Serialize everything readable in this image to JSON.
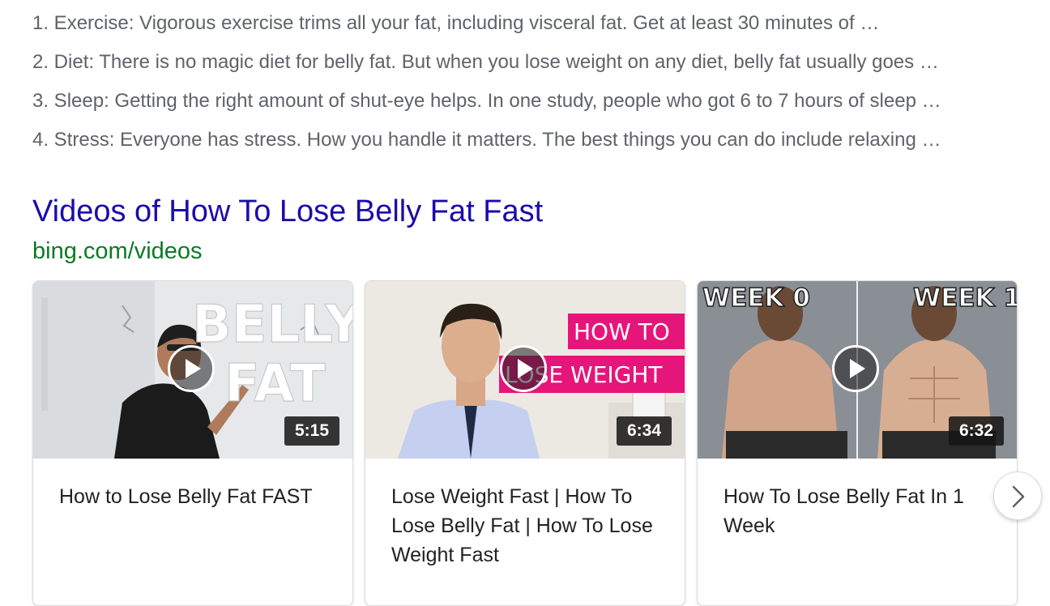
{
  "tips": [
    "1. Exercise: Vigorous exercise trims all your fat, including visceral fat. Get at least 30 minutes of …",
    "2. Diet: There is no magic diet for belly fat. But when you lose weight on any diet, belly fat usually goes …",
    "3. Sleep: Getting the right amount of shut-eye helps. In one study, people who got 6 to 7 hours of sleep …",
    "4. Stress: Everyone has stress. How you handle it matters. The best things you can do include relaxing …"
  ],
  "videos_section": {
    "title": "Videos of How To Lose Belly Fat Fast",
    "source": "bing.com/videos",
    "cards": [
      {
        "title": "How to Lose Belly Fat FAST",
        "duration": "5:15",
        "thumb_text": [
          "BELLY",
          "FAT"
        ]
      },
      {
        "title": "Lose Weight Fast | How To Lose Belly Fat | How To Lose Weight Fast",
        "duration": "6:34",
        "thumb_text": [
          "HOW TO",
          "LOSE WEIGHT"
        ]
      },
      {
        "title": "How To Lose Belly Fat In 1 Week",
        "duration": "6:32",
        "thumb_text": [
          "WEEK 0",
          "WEEK 1"
        ]
      }
    ],
    "next_icon": "chevron-right-icon",
    "play_icon": "play-icon"
  },
  "colors": {
    "link": "#1a0dab",
    "source": "#0b7a26",
    "snippet": "#5f6368",
    "pink_banner": "#e6157a"
  }
}
